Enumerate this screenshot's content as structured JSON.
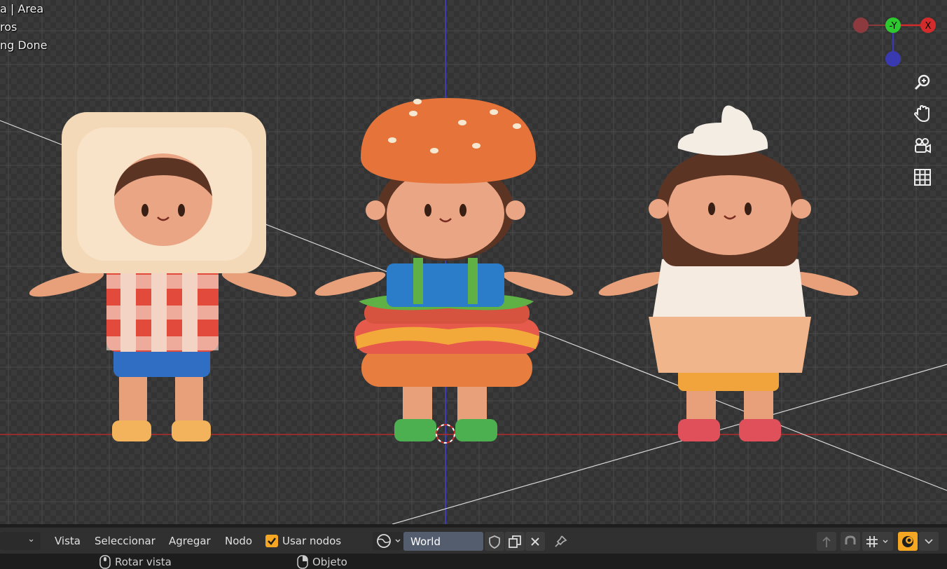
{
  "overlay": {
    "line1": "a | Area",
    "line2": "ros",
    "line3": "ng Done"
  },
  "gizmo": {
    "y_label": "-Y",
    "x_label": "X",
    "colors": {
      "x": "#d22b2b",
      "y": "#2ec92e",
      "z": "#3a3ab0"
    }
  },
  "nav_icons": [
    "zoom-icon",
    "hand-icon",
    "camera-icon",
    "grid-icon"
  ],
  "header": {
    "menu": [
      "Vista",
      "Seleccionar",
      "Agregar",
      "Nodo"
    ],
    "use_nodes_label": "Usar nodos",
    "use_nodes_checked": true,
    "world_value": "World"
  },
  "status": {
    "rotate": "Rotar vista",
    "object": "Objeto"
  },
  "accent": "#f5a623"
}
